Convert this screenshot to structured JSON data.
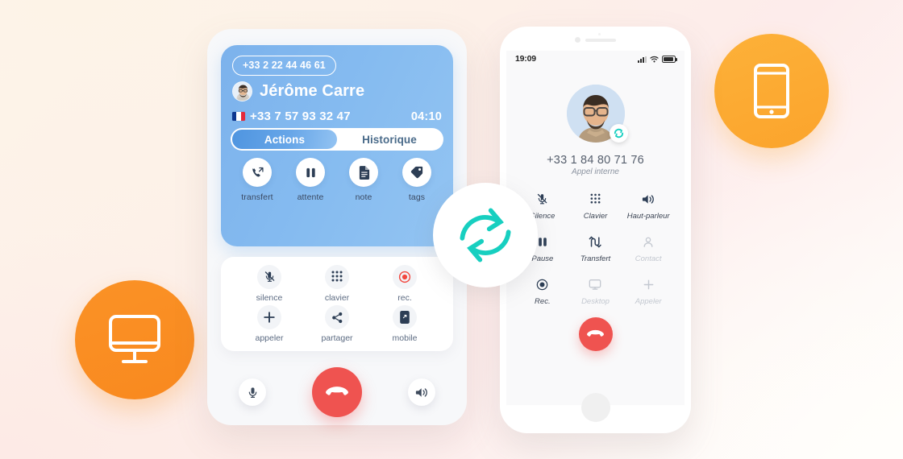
{
  "theme": {
    "accent_orange": "#f98e22",
    "accent_orange_light": "#fbaa32",
    "accent_teal": "#17cfc0",
    "accent_blue": "#4f95e0",
    "header_blue": "#85bbf0",
    "hangup_red": "#ef5350",
    "bg_cream": "#fdf4ea",
    "bg_pink": "#fdeae6"
  },
  "badges": {
    "desktop": {
      "icon": "desktop-monitor-icon",
      "label": "desktop"
    },
    "mobile": {
      "icon": "mobile-phone-icon",
      "label": "mobile"
    }
  },
  "center": {
    "icon": "sync-refresh-icon",
    "label": "sync"
  },
  "desktop_app": {
    "caller_id_pill": "+33 2 22 44 46 61",
    "caller_name": "Jérôme Carre",
    "caller_avatar": "contact-avatar",
    "caller_flag": "france-flag-icon",
    "caller_number": "+33 7 57 93 32 47",
    "call_timer": "04:10",
    "tabs": [
      {
        "label": "Actions",
        "active": true
      },
      {
        "label": "Historique",
        "active": false
      }
    ],
    "actions": [
      {
        "label": "transfert",
        "icon": "call-transfer-icon"
      },
      {
        "label": "attente",
        "icon": "pause-icon"
      },
      {
        "label": "note",
        "icon": "document-note-icon"
      },
      {
        "label": "tags",
        "icon": "tag-icon"
      }
    ],
    "functions": [
      {
        "label": "silence",
        "icon": "microphone-muted-icon",
        "state": "normal"
      },
      {
        "label": "clavier",
        "icon": "dialpad-icon",
        "state": "normal"
      },
      {
        "label": "rec.",
        "icon": "record-icon",
        "state": "recording"
      },
      {
        "label": "appeler",
        "icon": "plus-icon",
        "state": "normal"
      },
      {
        "label": "partager",
        "icon": "share-icon",
        "state": "normal"
      },
      {
        "label": "mobile",
        "icon": "mobile-device-icon",
        "state": "normal"
      }
    ],
    "controls": {
      "mic": {
        "icon": "microphone-icon",
        "label": "microphone"
      },
      "hangup": {
        "icon": "hangup-phone-icon",
        "label": "raccrocher"
      },
      "speaker": {
        "icon": "speaker-icon",
        "label": "haut-parleur"
      }
    }
  },
  "mobile_app": {
    "statusbar": {
      "time": "19:09",
      "signal_icon": "cellular-signal-icon",
      "wifi_icon": "wifi-icon",
      "battery_icon": "battery-icon"
    },
    "avatar": "contact-avatar",
    "sync_badge_icon": "sync-badge-icon",
    "phone_number": "+33 1 84 80 71 76",
    "call_type": "Appel interne",
    "buttons": [
      {
        "label": "Silence",
        "icon": "microphone-muted-icon",
        "disabled": false
      },
      {
        "label": "Clavier",
        "icon": "dialpad-icon",
        "disabled": false
      },
      {
        "label": "Haut-parleur",
        "icon": "speaker-icon",
        "disabled": false
      },
      {
        "label": "Pause",
        "icon": "pause-icon",
        "disabled": false
      },
      {
        "label": "Transfert",
        "icon": "call-transfer-icon",
        "disabled": false
      },
      {
        "label": "Contact",
        "icon": "person-icon",
        "disabled": true
      },
      {
        "label": "Rec.",
        "icon": "record-icon",
        "disabled": false
      },
      {
        "label": "Desktop",
        "icon": "desktop-monitor-icon",
        "disabled": true
      },
      {
        "label": "Appeler",
        "icon": "plus-icon",
        "disabled": true
      }
    ],
    "hangup": {
      "icon": "hangup-phone-icon",
      "label": "raccrocher"
    },
    "home_button": "home-button"
  }
}
